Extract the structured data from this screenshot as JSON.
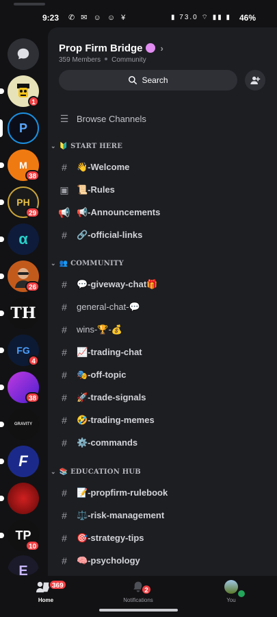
{
  "status_bar": {
    "time": "9:23",
    "left_icons": "✆ ✉ ☺ ☺ ¥",
    "right_icons": "▮ 73.0 ⌔ ▮▮ ▮",
    "battery": "46%"
  },
  "rail": {
    "servers": [
      {
        "kind": "dm",
        "initials": "",
        "color": "#2e3036",
        "badge": ""
      },
      {
        "kind": "server",
        "initials": "",
        "color": "#e8e2b8",
        "badge": "1",
        "unread": true
      },
      {
        "kind": "server",
        "initials": "P",
        "color": "#0b0e18",
        "badge": "",
        "selected": true
      },
      {
        "kind": "server",
        "initials": "M",
        "color": "#f07a12",
        "badge": "38",
        "unread": true
      },
      {
        "kind": "server",
        "initials": "PH",
        "color": "#1a1a1a",
        "badge": "29",
        "unread": true
      },
      {
        "kind": "server",
        "initials": "α",
        "color": "#0e1b3a",
        "badge": "",
        "unread": true
      },
      {
        "kind": "server",
        "initials": "",
        "color": "#c25a1c",
        "badge": "26",
        "unread": true
      },
      {
        "kind": "server",
        "initials": "TH",
        "color": "#111111",
        "badge": "",
        "unread": true
      },
      {
        "kind": "server",
        "initials": "FG",
        "color": "#0d1a33",
        "badge": "4",
        "unread": true
      },
      {
        "kind": "server",
        "initials": "",
        "color": "#7a2fd0",
        "badge": "38",
        "unread": true
      },
      {
        "kind": "server",
        "initials": "GRAVITY",
        "color": "#111111",
        "badge": "",
        "unread": true
      },
      {
        "kind": "server",
        "initials": "F",
        "color": "#1b2a8a",
        "badge": "",
        "unread": true
      },
      {
        "kind": "server",
        "initials": "",
        "color": "#a01010",
        "badge": "",
        "unread": true
      },
      {
        "kind": "server",
        "initials": "TP",
        "color": "#111111",
        "badge": "10",
        "unread": true
      },
      {
        "kind": "server",
        "initials": "E",
        "color": "#1a1a2a",
        "badge": "",
        "unread": true
      }
    ]
  },
  "server": {
    "name": "Prop Firm Bridge",
    "members": "359 Members",
    "community": "Community",
    "search_label": "Search"
  },
  "browse_channels": "Browse Channels",
  "categories": [
    {
      "name": "🔰 START HERE"
    },
    {
      "name": "👥 COMMUNITY"
    },
    {
      "name": "📚 EDUCATION HUB"
    }
  ],
  "channels": [
    {
      "icon": "#",
      "name": "👋-Welcome",
      "bold": true
    },
    {
      "icon": "▣",
      "name": "📜-Rules",
      "bold": true
    },
    {
      "icon": "📢",
      "name": "📢-Announcements",
      "bold": true
    },
    {
      "icon": "#",
      "name": "🔗-official-links",
      "bold": true
    },
    {
      "icon": "#",
      "name": "💬-giveway-chat🎁",
      "bold": true
    },
    {
      "icon": "#",
      "name": "general-chat-💬",
      "bold": false
    },
    {
      "icon": "#",
      "name": "wins-🏆-💰",
      "bold": false
    },
    {
      "icon": "#",
      "name": "📈-trading-chat",
      "bold": true
    },
    {
      "icon": "#",
      "name": "🎭-off-topic",
      "bold": true
    },
    {
      "icon": "#",
      "name": "🚀-trade-signals",
      "bold": true
    },
    {
      "icon": "#",
      "name": "🤣-trading-memes",
      "bold": true
    },
    {
      "icon": "#",
      "name": "⚙️-commands",
      "bold": true
    },
    {
      "icon": "#",
      "name": "📝-propfirm-rulebook",
      "bold": true
    },
    {
      "icon": "#",
      "name": "⚖️-risk-management",
      "bold": true
    },
    {
      "icon": "#",
      "name": "🎯-strategy-tips",
      "bold": true
    },
    {
      "icon": "#",
      "name": "🧠-psychology",
      "bold": true
    }
  ],
  "nav": {
    "home": "Home",
    "home_badge": "369",
    "notifications": "Notifications",
    "notifications_badge": "2",
    "you": "You"
  },
  "colors": {
    "accent": "#5865f2",
    "badge": "#f23f43",
    "online": "#23a55a"
  }
}
